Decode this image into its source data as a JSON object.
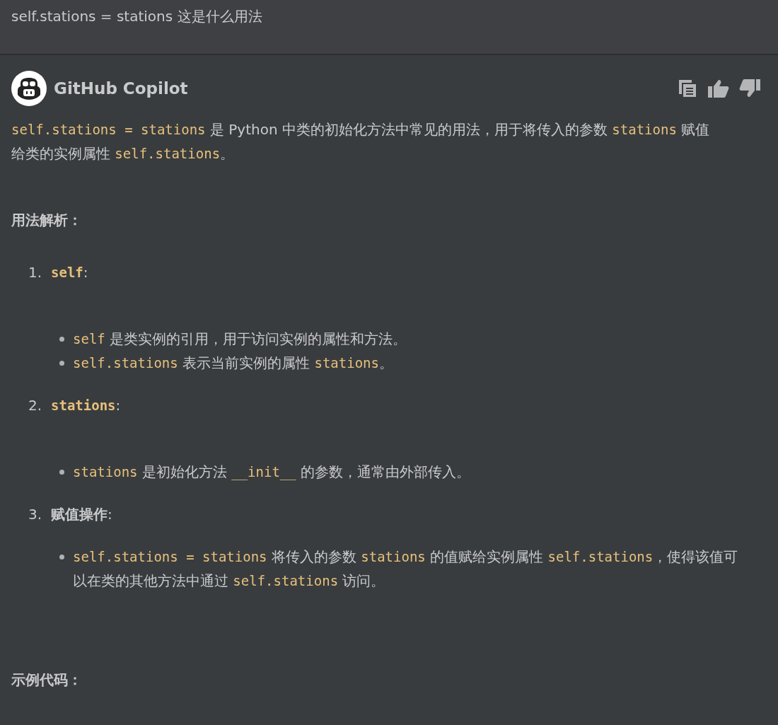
{
  "question": {
    "text": "self.stations = stations 这是什么用法"
  },
  "answer": {
    "author": "GitHub Copilot",
    "actions": [
      {
        "kind": "copy"
      },
      {
        "kind": "thumbs-up"
      },
      {
        "kind": "thumbs-down"
      }
    ],
    "blocks": [
      {
        "kind": "paragraph",
        "segments": [
          {
            "kind": "code",
            "text": "self.stations = stations"
          },
          {
            "kind": "text",
            "text": " 是 Python 中类的初始化方法中常见的用法，用于将传入的参数 "
          },
          {
            "kind": "code",
            "text": "stations"
          },
          {
            "kind": "text",
            "text": " 赋值给类的实例属性 "
          },
          {
            "kind": "code",
            "text": "self.stations"
          },
          {
            "kind": "text",
            "text": "。"
          }
        ]
      },
      {
        "kind": "heading",
        "text": "用法解析："
      },
      {
        "kind": "ordered",
        "items": [
          {
            "number": "1.",
            "title": [
              {
                "kind": "code-bold",
                "text": "self"
              },
              {
                "kind": "text",
                "text": ":"
              }
            ],
            "bullets": [
              [
                {
                  "kind": "code",
                  "text": "self"
                },
                {
                  "kind": "text",
                  "text": " 是类实例的引用，用于访问实例的属性和方法。"
                }
              ],
              [
                {
                  "kind": "code",
                  "text": "self.stations"
                },
                {
                  "kind": "text",
                  "text": " 表示当前实例的属性 "
                },
                {
                  "kind": "code",
                  "text": "stations"
                },
                {
                  "kind": "text",
                  "text": "。"
                }
              ]
            ]
          },
          {
            "number": "2.",
            "title": [
              {
                "kind": "code-bold",
                "text": "stations"
              },
              {
                "kind": "text",
                "text": ":"
              }
            ],
            "bullets": [
              [
                {
                  "kind": "code",
                  "text": "stations"
                },
                {
                  "kind": "text",
                  "text": " 是初始化方法 "
                },
                {
                  "kind": "code",
                  "text": "__init__"
                },
                {
                  "kind": "text",
                  "text": " 的参数，通常由外部传入。"
                }
              ]
            ]
          },
          {
            "number": "3.",
            "title": [
              {
                "kind": "bold",
                "text": "赋值操作"
              },
              {
                "kind": "text",
                "text": ":"
              }
            ],
            "bullets": [
              [
                {
                  "kind": "code",
                  "text": "self.stations = stations"
                },
                {
                  "kind": "text",
                  "text": " 将传入的参数 "
                },
                {
                  "kind": "code",
                  "text": "stations"
                },
                {
                  "kind": "text",
                  "text": " 的值赋给实例属性 "
                },
                {
                  "kind": "code",
                  "text": "self.stations"
                },
                {
                  "kind": "text",
                  "text": "，使得该值可以在类的其他方法中通过 "
                },
                {
                  "kind": "code",
                  "text": "self.stations"
                },
                {
                  "kind": "text",
                  "text": " 访问。"
                }
              ]
            ]
          }
        ]
      },
      {
        "kind": "heading",
        "text": "示例代码："
      }
    ]
  }
}
